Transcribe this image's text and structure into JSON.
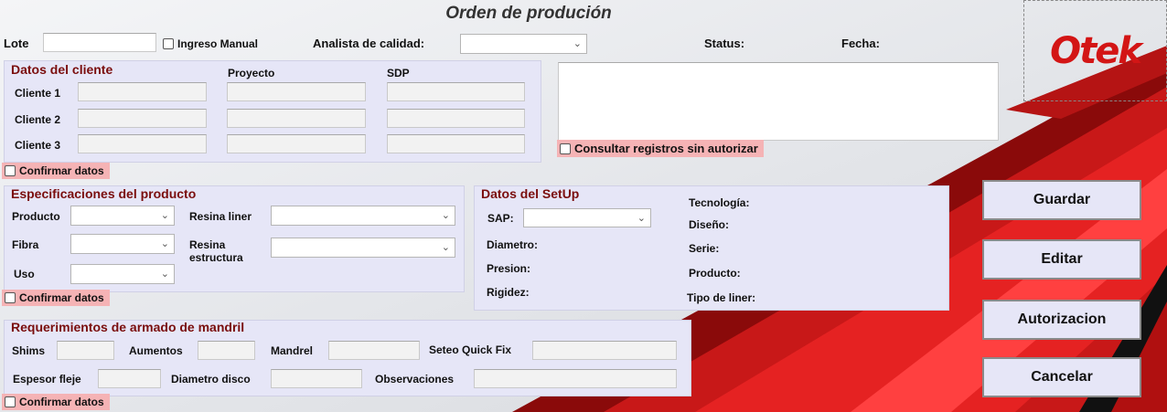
{
  "title": "Orden de produción",
  "header": {
    "lote_label": "Lote",
    "lote_value": "",
    "ingreso_manual_label": "Ingreso Manual",
    "analista_label": "Analista de calidad:",
    "analista_value": "",
    "status_label": "Status:",
    "fecha_label": "Fecha:",
    "logo_text": "Otek"
  },
  "cliente": {
    "title": "Datos del cliente",
    "proyecto_header": "Proyecto",
    "sdp_header": "SDP",
    "rows": [
      {
        "label": "Cliente 1",
        "cliente": "",
        "proyecto": "",
        "sdp": ""
      },
      {
        "label": "Cliente 2",
        "cliente": "",
        "proyecto": "",
        "sdp": ""
      },
      {
        "label": "Cliente 3",
        "cliente": "",
        "proyecto": "",
        "sdp": ""
      }
    ],
    "confirm_label": "Confirmar datos"
  },
  "registros": {
    "textarea_value": "",
    "consultar_label": "Consultar registros sin autorizar"
  },
  "especificaciones": {
    "title": "Especificaciones del producto",
    "producto_label": "Producto",
    "fibra_label": "Fibra",
    "uso_label": "Uso",
    "resina_liner_label": "Resina liner",
    "resina_estructura_label_1": "Resina",
    "resina_estructura_label_2": "estructura",
    "confirm_label": "Confirmar datos"
  },
  "setup": {
    "title": "Datos del SetUp",
    "sap_label": "SAP:",
    "diametro_label": "Diametro:",
    "presion_label": "Presion:",
    "rigidez_label": "Rigidez:",
    "tecnologia_label": "Tecnología:",
    "diseno_label": "Diseño:",
    "serie_label": "Serie:",
    "producto_label": "Producto:",
    "tipo_liner_label": "Tipo de liner:"
  },
  "mandril": {
    "title": "Requerimientos de armado de mandril",
    "shims_label": "Shims",
    "aumentos_label": "Aumentos",
    "mandrel_label": "Mandrel",
    "seteo_label": "Seteo Quick Fix",
    "espesor_label": "Espesor fleje",
    "diametro_disco_label": "Diametro disco",
    "observaciones_label": "Observaciones",
    "confirm_label": "Confirmar datos"
  },
  "buttons": {
    "guardar": "Guardar",
    "editar": "Editar",
    "autorizacion": "Autorizacion",
    "cancelar": "Cancelar"
  },
  "colors": {
    "accent_red": "#d31515",
    "group_bg": "#e6e6f7",
    "group_title": "#7a0d0d",
    "confirm_bg": "#f5b3b5"
  }
}
